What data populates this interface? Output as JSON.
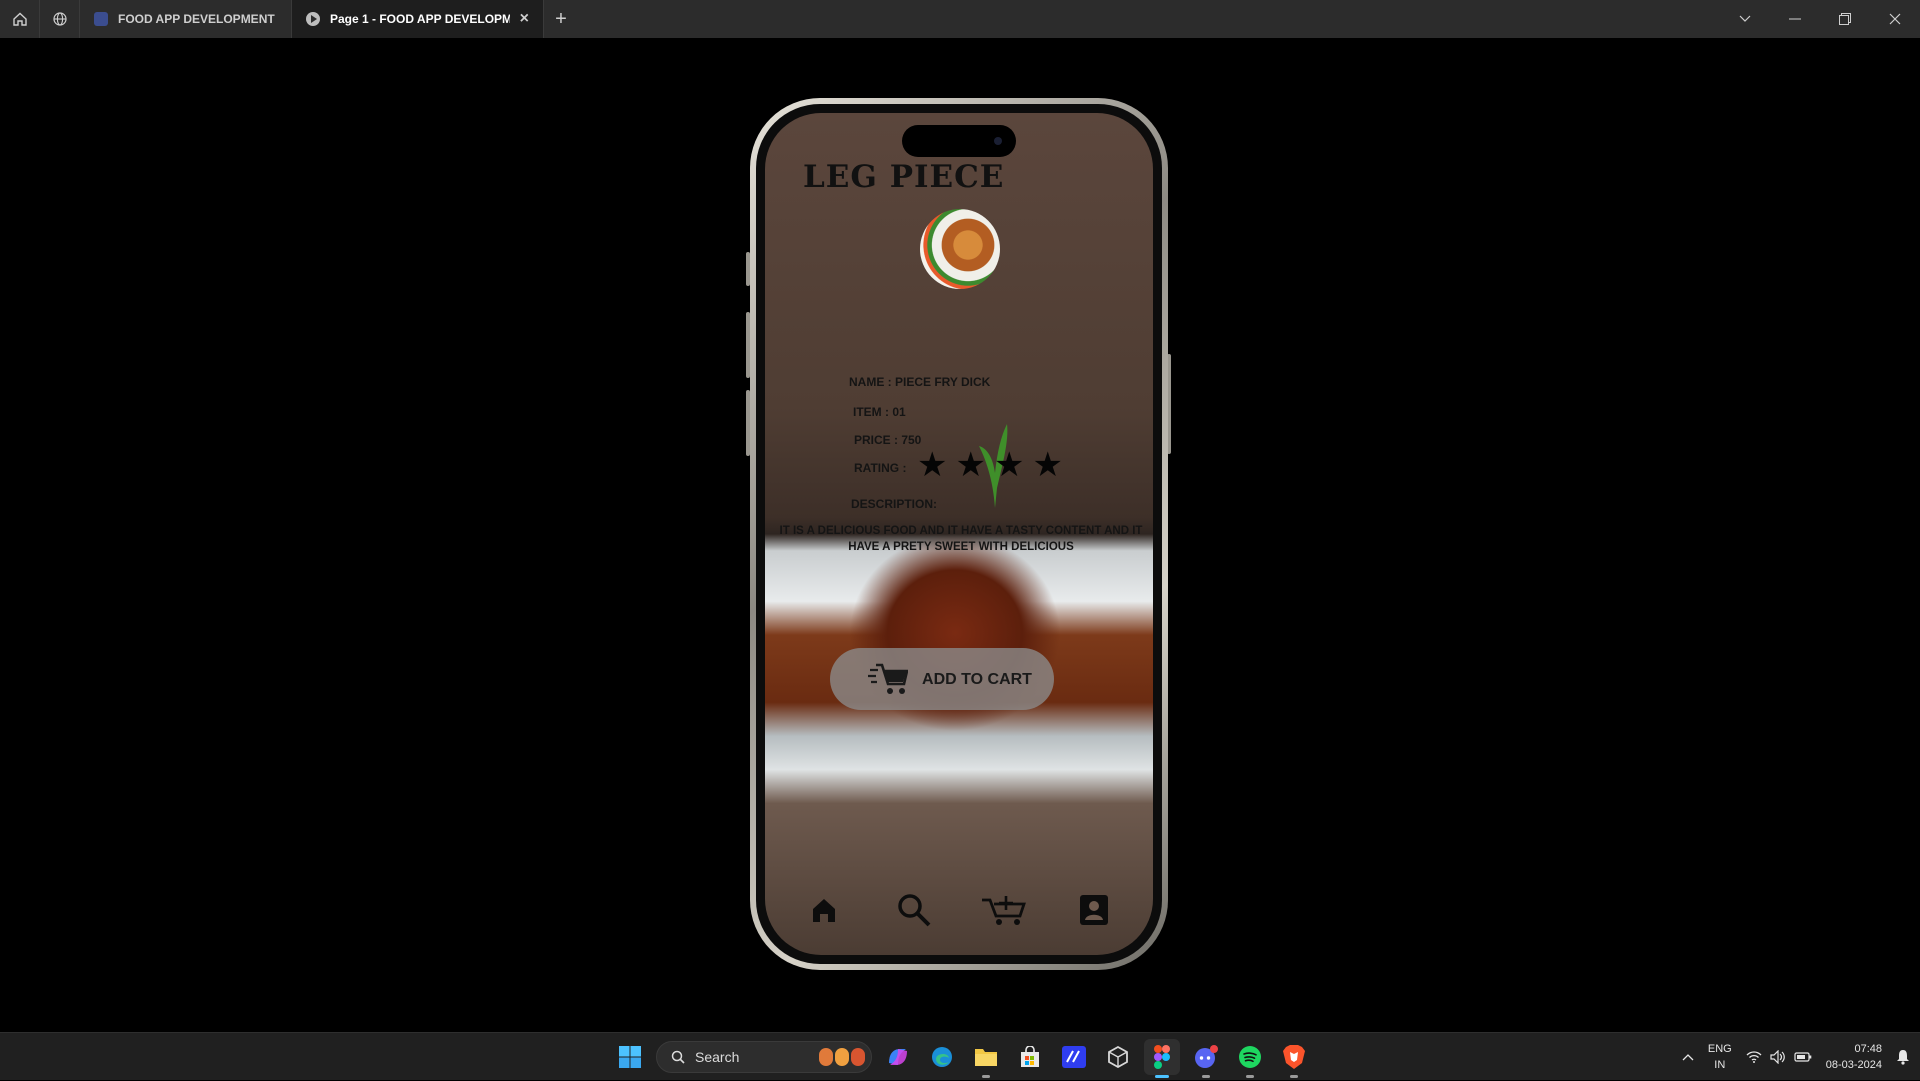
{
  "browser": {
    "tabs": [
      {
        "label": "FOOD APP DEVELOPMENT",
        "active": false
      },
      {
        "label": "Page 1 - FOOD APP DEVELOPMEN",
        "active": true
      }
    ]
  },
  "product": {
    "title": "LEG PIECE",
    "name": "NAME  :  PIECE FRY DICK",
    "item": "ITEM   :  01",
    "price": "PRICE :  750",
    "rating_label": "RATING  :",
    "rating": 4,
    "description_label": "DESCRIPTION:",
    "description": "IT IS A DELICIOUS FOOD AND IT HAVE A TASTY CONTENT AND IT HAVE A PRETY  SWEET WITH DELICIOUS",
    "add_to_cart": "ADD TO CART"
  },
  "bottom_nav": [
    "home-icon",
    "search-icon",
    "cart-icon",
    "profile-icon"
  ],
  "taskbar": {
    "search_label": "Search",
    "apps": [
      "copilot",
      "edge",
      "file-explorer",
      "store",
      "vscode",
      "unity",
      "figma",
      "discord",
      "spotify",
      "brave"
    ],
    "language": "ENG",
    "region": "IN",
    "time": "07:48",
    "date": "08-03-2024"
  },
  "colors": {
    "titlebar": "#2c2c2c",
    "taskbar": "#202020",
    "accent": "#4cc2ff",
    "button": "#8c8c8c"
  }
}
